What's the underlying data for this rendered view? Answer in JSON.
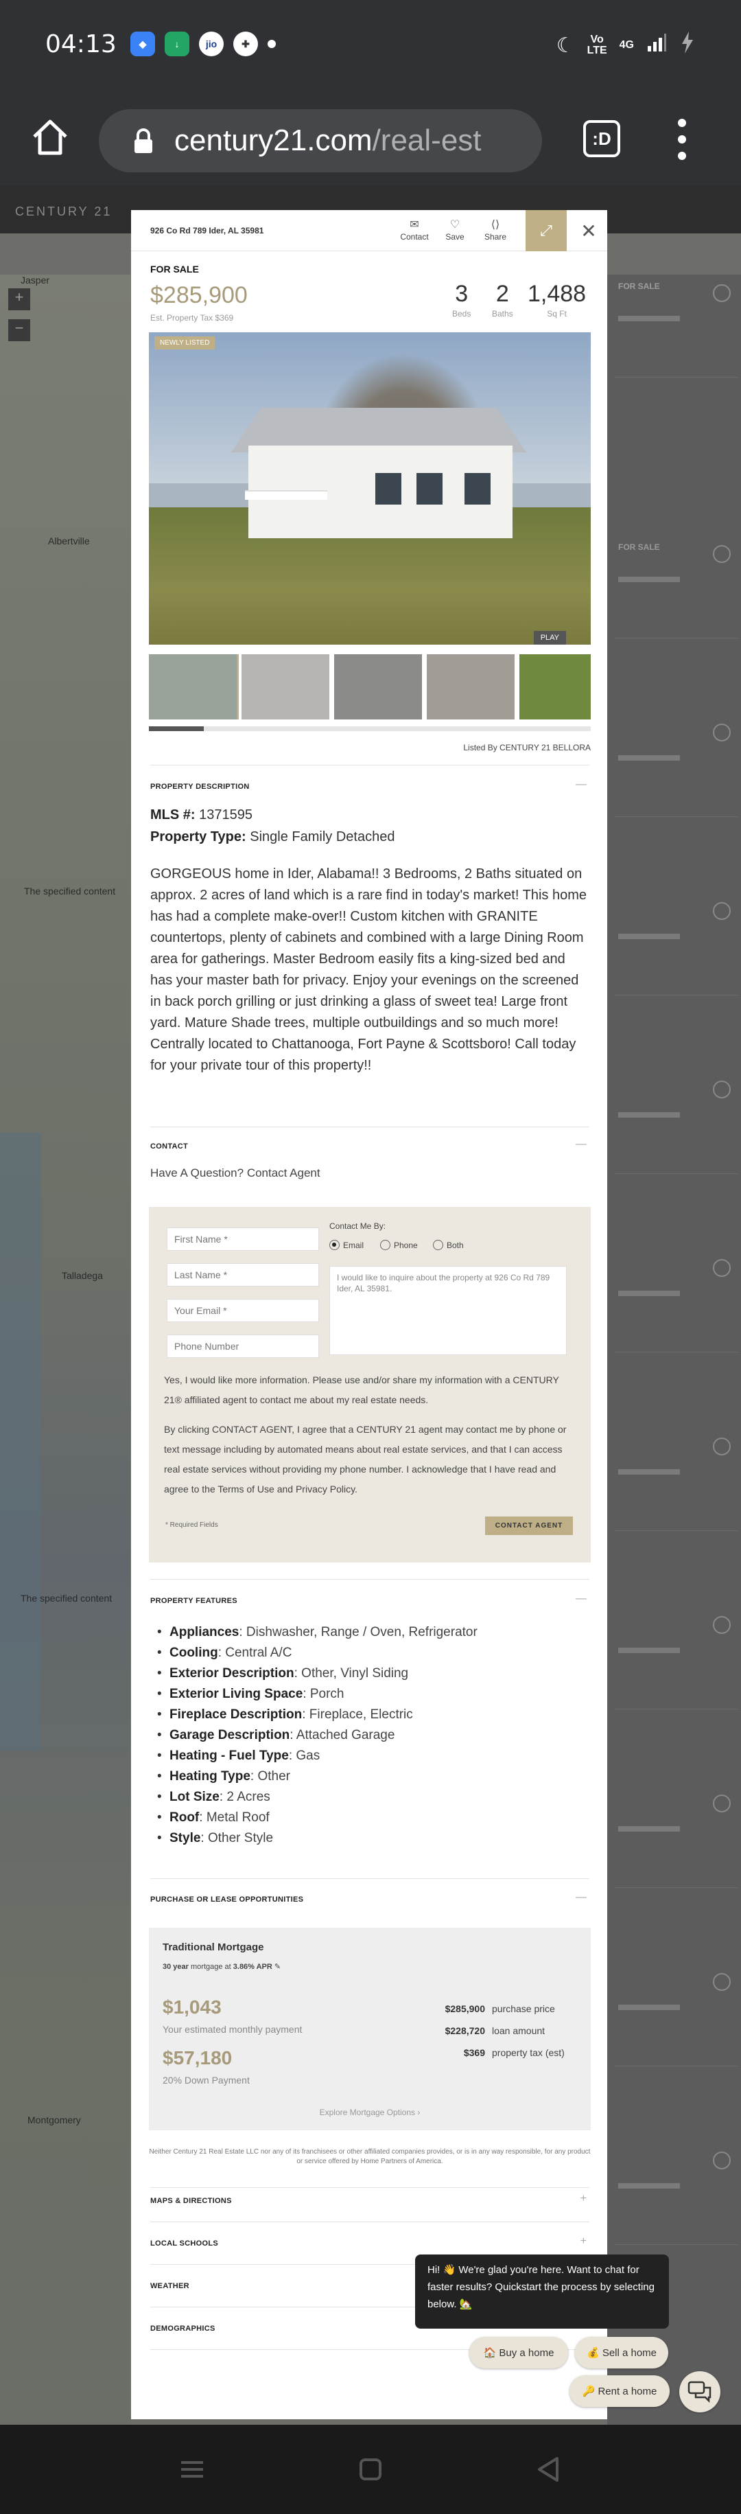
{
  "status_bar": {
    "time": "04:13",
    "lte": "Vo\nLTE",
    "network": "4G",
    "battery_icon": "charging-bolt"
  },
  "browser": {
    "url_domain": "century21.com",
    "url_path": "/real-est",
    "tab_count": ":D"
  },
  "background": {
    "logo": "CENTURY 21",
    "map_labels": [
      "Jasper",
      "Albertville",
      "The specified content",
      "Talladega",
      "Montgomery"
    ],
    "list_price_samples": [
      "FOR SALE",
      "FOR SALE",
      "FOR SALE"
    ]
  },
  "listing": {
    "address": "926 Co Rd 789 Ider, AL 35981",
    "actions": {
      "contact": "Contact",
      "save": "Save",
      "share": "Share"
    },
    "status": "FOR SALE",
    "price": "$285,900",
    "est_tax": "Est. Property Tax $369",
    "beds": "3",
    "beds_label": "Beds",
    "baths": "2",
    "baths_label": "Baths",
    "sqft": "1,488",
    "sqft_label": "Sq Ft",
    "photo_badge": "NEWLY LISTED",
    "play_label": "PLAY",
    "listed_by": "Listed By CENTURY 21 BELLORA"
  },
  "description": {
    "heading": "PROPERTY DESCRIPTION",
    "mls_label": "MLS #:",
    "mls": "1371595",
    "type_label": "Property Type:",
    "type": "Single Family Detached",
    "text": "GORGEOUS home in Ider, Alabama!! 3 Bedrooms, 2 Baths situated on approx. 2 acres of land which is a rare find in today's market! This home has had a complete make-over!! Custom kitchen with GRANITE countertops, plenty of cabinets and combined with a large Dining Room area for gatherings. Master Bedroom easily fits a king-sized bed and has your master bath for privacy. Enjoy your evenings on the screened in back porch grilling or just drinking a glass of sweet tea! Large front yard. Mature Shade trees, multiple outbuildings and so much more! Centrally located to Chattanooga, Fort Payne & Scottsboro! Call today for your private tour of this property!!"
  },
  "contact": {
    "heading": "CONTACT",
    "question": "Have A Question? Contact Agent",
    "first_name": "First Name *",
    "last_name": "Last Name *",
    "email": "Your Email *",
    "phone": "Phone Number",
    "contact_by": "Contact Me By:",
    "opt_email": "Email",
    "opt_phone": "Phone",
    "opt_both": "Both",
    "message": "I would like to inquire about the property at 926 Co Rd 789 Ider, AL 35981.",
    "consent1": "Yes, I would like more information. Please use and/or share my information with a CENTURY 21® affiliated agent to contact me about my real estate needs.",
    "consent2": "By clicking CONTACT AGENT, I agree that a CENTURY 21 agent may contact me by phone or text message including by automated means about real estate services, and that I can access real estate services without providing my phone number. I acknowledge that I have read and agree to the Terms of Use and Privacy Policy.",
    "required": "* Required Fields",
    "button": "CONTACT AGENT"
  },
  "features": {
    "heading": "PROPERTY FEATURES",
    "items": [
      {
        "k": "Appliances",
        "v": ": Dishwasher, Range / Oven, Refrigerator"
      },
      {
        "k": "Cooling",
        "v": ": Central A/C"
      },
      {
        "k": "Exterior Description",
        "v": ": Other, Vinyl Siding"
      },
      {
        "k": "Exterior Living Space",
        "v": ": Porch"
      },
      {
        "k": "Fireplace Description",
        "v": ": Fireplace, Electric"
      },
      {
        "k": "Garage Description",
        "v": ": Attached Garage"
      },
      {
        "k": "Heating - Fuel Type",
        "v": ": Gas"
      },
      {
        "k": "Heating Type",
        "v": ": Other"
      },
      {
        "k": "Lot Size",
        "v": ": 2 Acres"
      },
      {
        "k": "Roof",
        "v": ": Metal Roof"
      },
      {
        "k": "Style",
        "v": ": Other Style"
      }
    ]
  },
  "mortgage": {
    "heading": "PURCHASE OR LEASE OPPORTUNITIES",
    "title": "Traditional Mortgage",
    "sub_year": "30 year",
    "sub_rest": " mortgage at ",
    "apr": "3.86% APR",
    "monthly": "$1,043",
    "monthly_label": "Your estimated monthly payment",
    "down": "$57,180",
    "down_label": "20% Down Payment",
    "rows": [
      {
        "v": "$285,900",
        "k": "purchase price"
      },
      {
        "v": "$228,720",
        "k": "loan amount"
      },
      {
        "v": "$369",
        "k": "property tax (est)"
      }
    ],
    "link": "Explore Mortgage Options ›",
    "disclaimer": "Neither Century 21 Real Estate LLC nor any of its franchisees or other affiliated companies provides, or is in any way responsible, for any product or service offered by Home Partners of America."
  },
  "collapsed_sections": [
    "MAPS & DIRECTIONS",
    "LOCAL SCHOOLS",
    "WEATHER",
    "DEMOGRAPHICS"
  ],
  "chat": {
    "message": "Hi! 👋 We're glad you're here. Want to chat for faster results? Quickstart the process by selecting below. 🏡",
    "buy": "🏠 Buy a home",
    "sell": "💰 Sell a home",
    "rent": "🔑 Rent a home"
  },
  "colors": {
    "accent": "#beaf87",
    "price": "#a69a7a",
    "chrome": "#303134"
  }
}
